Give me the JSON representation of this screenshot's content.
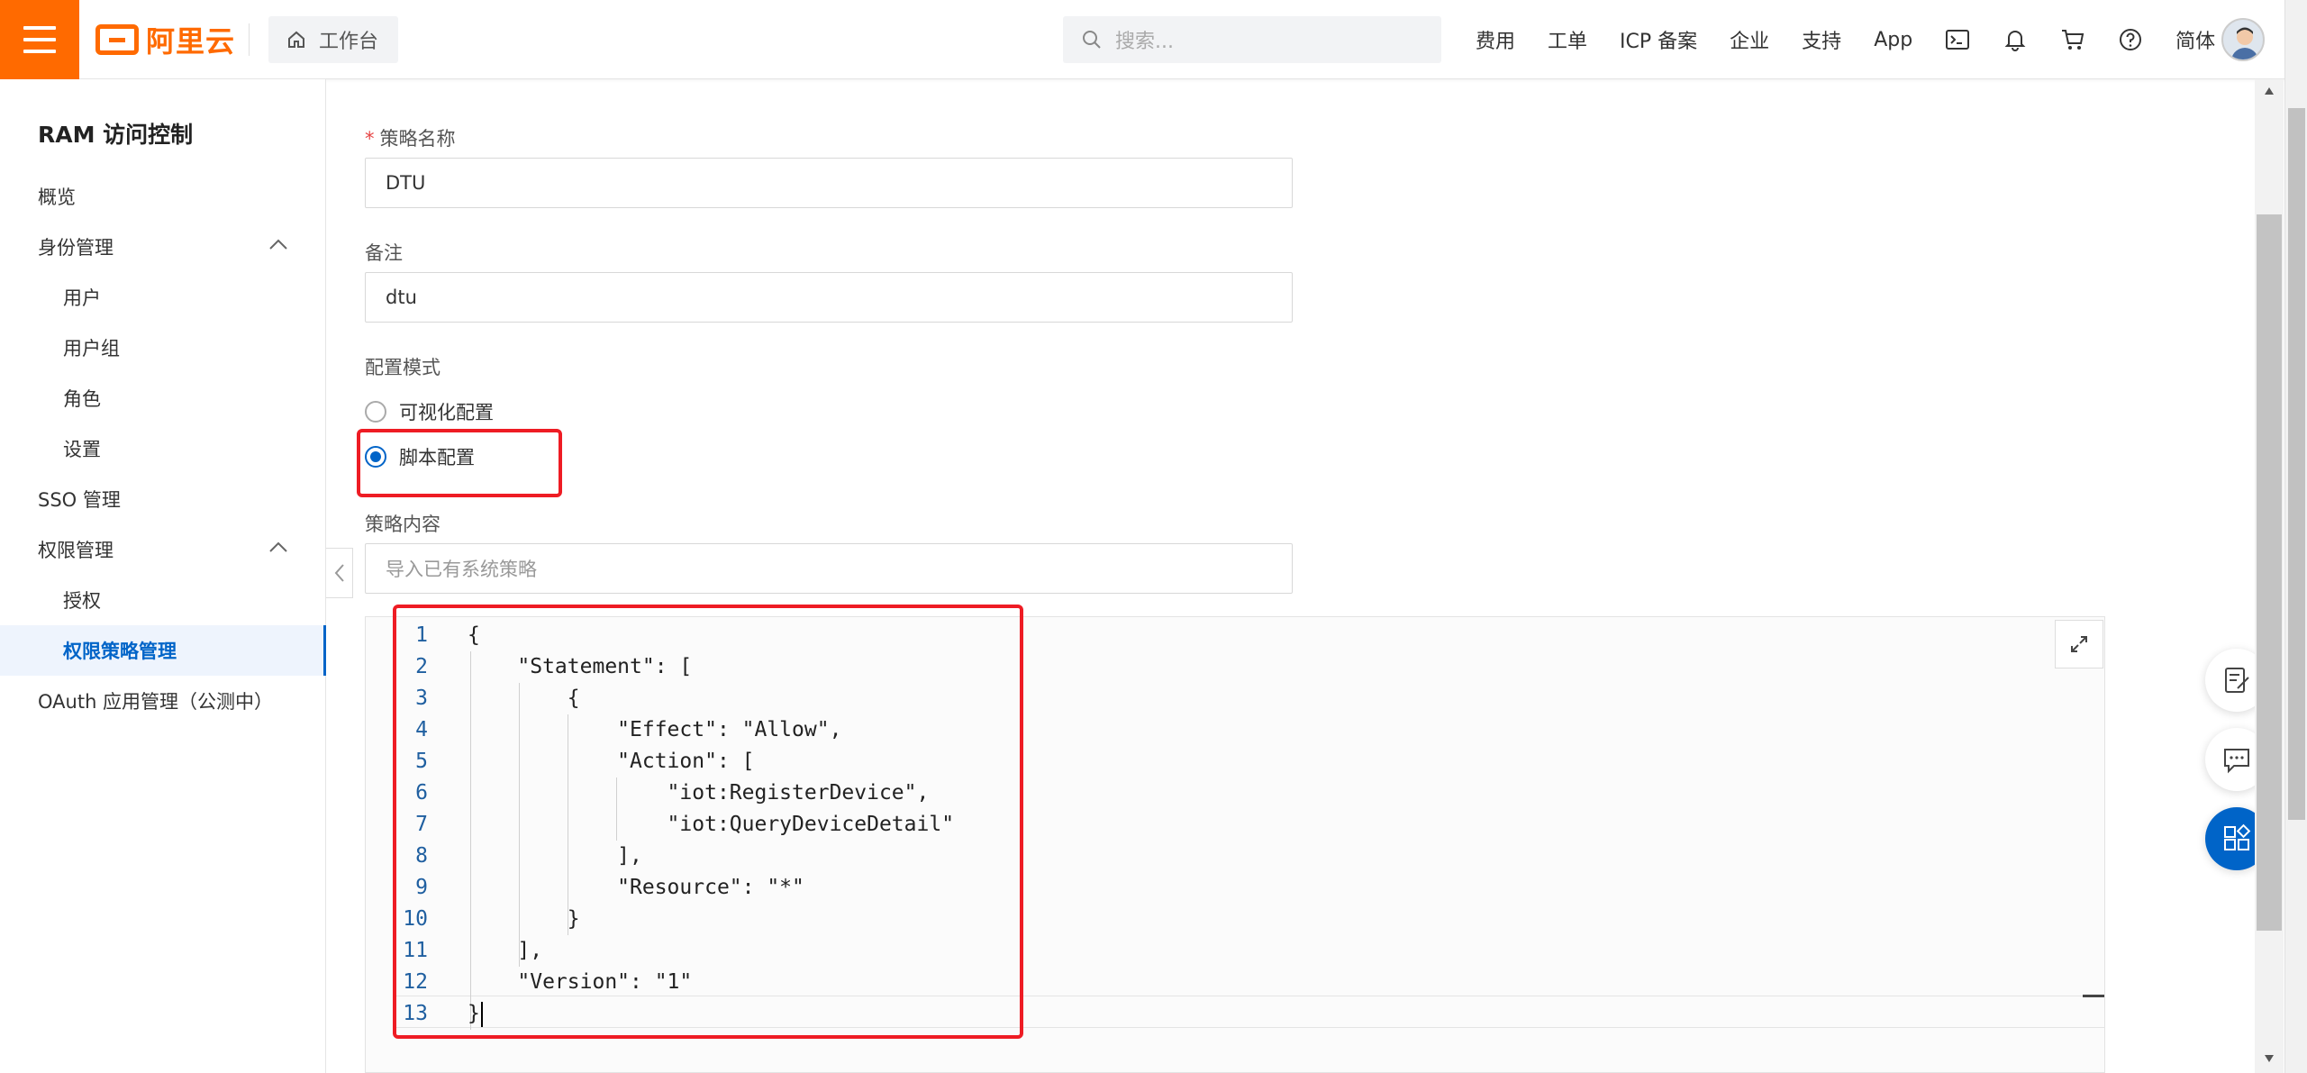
{
  "topbar": {
    "logo_text": "阿里云",
    "workbench": "工作台",
    "search_placeholder": "搜索...",
    "nav": [
      "费用",
      "工单",
      "ICP 备案",
      "企业",
      "支持",
      "App"
    ],
    "lang": "简体",
    "icons": [
      "terminal-icon",
      "bell-icon",
      "cart-icon",
      "help-icon"
    ]
  },
  "sidebar": {
    "title": "RAM 访问控制",
    "items": [
      {
        "label": "概览",
        "level": 1
      },
      {
        "label": "身份管理",
        "level": 1,
        "expanded": true
      },
      {
        "label": "用户",
        "level": 2
      },
      {
        "label": "用户组",
        "level": 2
      },
      {
        "label": "角色",
        "level": 2
      },
      {
        "label": "设置",
        "level": 2
      },
      {
        "label": "SSO 管理",
        "level": 1
      },
      {
        "label": "权限管理",
        "level": 1,
        "expanded": true
      },
      {
        "label": "授权",
        "level": 2
      },
      {
        "label": "权限策略管理",
        "level": 2,
        "active": true
      },
      {
        "label": "OAuth 应用管理（公测中）",
        "level": 1
      }
    ]
  },
  "form": {
    "name_label": "策略名称",
    "name_required": "*",
    "name_value": "DTU",
    "remark_label": "备注",
    "remark_value": "dtu",
    "mode_label": "配置模式",
    "mode_options": [
      "可视化配置",
      "脚本配置"
    ],
    "mode_selected": "脚本配置",
    "content_label": "策略内容",
    "import_placeholder": "导入已有系统策略"
  },
  "editor": {
    "lines": [
      "{",
      "    \"Statement\": [",
      "        {",
      "            \"Effect\": \"Allow\",",
      "            \"Action\": [",
      "                \"iot:RegisterDevice\",",
      "                \"iot:QueryDeviceDetail\"",
      "            ],",
      "            \"Resource\": \"*\"",
      "        }",
      "    ],",
      "    \"Version\": \"1\"",
      "}"
    ],
    "line_numbers": [
      "1",
      "2",
      "3",
      "4",
      "5",
      "6",
      "7",
      "8",
      "9",
      "10",
      "11",
      "12",
      "13"
    ]
  },
  "colors": {
    "brand": "#ff6a00",
    "accent": "#0064c8",
    "highlight_box": "#ee1c24"
  }
}
